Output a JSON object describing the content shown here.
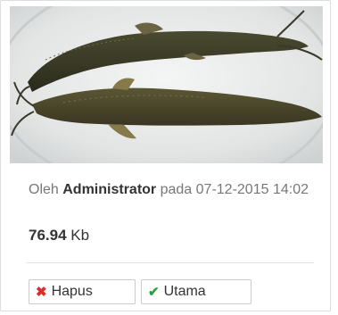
{
  "image": {
    "alt": "catfish-photo"
  },
  "meta": {
    "prefix": "Oleh",
    "author": "Administrator",
    "middle": "pada",
    "date": "07-12-2015 14:02"
  },
  "file": {
    "size_value": "76.94",
    "size_unit": "Kb"
  },
  "actions": {
    "delete_label": "Hapus",
    "delete_icon": "cross-icon",
    "main_label": "Utama",
    "main_icon": "check-icon"
  },
  "colors": {
    "delete_icon": "#d9302c",
    "main_icon": "#2e9e3e",
    "border": "#cccccc"
  }
}
